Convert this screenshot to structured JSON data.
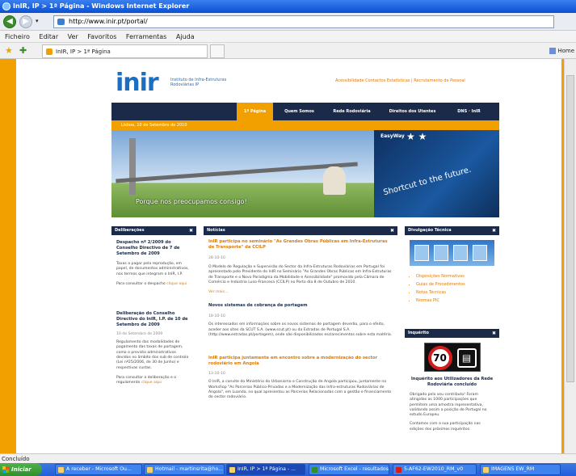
{
  "window": {
    "title": "InIR, IP > 1ª Página - Windows Internet Explorer"
  },
  "address": {
    "url": "http://www.inir.pt/portal/"
  },
  "menu": [
    "Ficheiro",
    "Editar",
    "Ver",
    "Favoritos",
    "Ferramentas",
    "Ajuda"
  ],
  "tab": {
    "label": "InIR, IP > 1ª Página"
  },
  "home_label": "Home",
  "site": {
    "logo_text": "inir",
    "logo_tagline": "Instituto de Infra-Estruturas Rodoviárias IP",
    "top_links": "Acessibilidade  Contactos  Estatísticas  |  Recrutamento de Pessoal",
    "nav": [
      "1ª Página",
      "Quem Somos",
      "Rede Rodoviária",
      "Direitos dos Utentes",
      "DNS · InIR"
    ],
    "date_text": "Lisboa, 10 de Setembro de 2010",
    "banner_caption": "Porque nos preocupamos consigo!",
    "banner_easyway": "EasyWay",
    "banner_shortcut": "Shortcut to the future.",
    "deliberacoes": {
      "heading": "Deliberações",
      "items": [
        {
          "title": "Despacho nº 2/2009 do Conselho Directivo de 7 de Setembro de 2009",
          "body": "Taxas a pagar pela reprodução, em papel, de documentos administrativos, nos termos que integram o InIR, I.P.",
          "cta": "Para consultar o despacho",
          "link": "clique aqui"
        },
        {
          "title": "Deliberação do Conselho Directivo do InIR, I.P. de 10 de Setembro de 2009",
          "date": "10 de Setembro de 2009",
          "body": "Regulamento das modalidades de pagamento das taxas de portagem, como o previsto administrativos devidos no âmbito dos sub de controlo (Lei nº25/2006, de 30 de Junho) e respectivas custas.",
          "cta": "Para consultar a deliberação e o regulamento",
          "link": "clique aqui"
        }
      ]
    },
    "noticias": {
      "heading": "Notícias",
      "items": [
        {
          "title": "InIR participa no seminário \"As Grandes Obras Públicas em Infra-Estruturas de Transporte\" da CCILP",
          "date": "28-10-10",
          "body": "O Modelo de Regulação e Supervisão do Sector da Infra-Estruturas Rodoviárias em Portugal foi apresentado pelo Presidente do InIR no Seminário \"As Grandes Obras Públicas em Infra-Estruturas de Transporte e o Novo Paradigma da Mobilidade e Acessibilidade\" promovido pela Câmara de Comércio e Indústria Luso-Francesa (CCILP) no Porto dia 8 de Outubro de 2010.",
          "more": "Ver mais..."
        },
        {
          "title": "Novos sistemas de cobrança de portagem",
          "date": "18-10-10",
          "body": "Os interessados em informações sobre os novos sistemas de portagem deverão, para o efeito, aceder aos sites da SCUT S.A. (www.scut.pt) ou da Estradas de Portugal S.A. (http://www.estradas.pt/portagem), onde são disponibilizados esclarecimentos sobre esta matéria."
        },
        {
          "title": "InIR participa juntamente em encontro sobre a modernização do sector rodoviário em Angola",
          "date": "13-10-10",
          "body": "O InIR, a convite do Ministério do Urbanismo e Construção de Angola participou, juntamente no Workshop \"As Parcerias Público-Privadas e a Modernização das Infra-estruturas Rodoviárias de Angola\", em Luanda, no qual apresentou as Parcerias Relacionadas com a gestão e financiamento do sector rodoviário."
        }
      ]
    },
    "divulgacao": {
      "heading": "Divulgação Técnica",
      "links": [
        "Disposições Normativas",
        "Guias de Procedimentos",
        "Notas Técnicas",
        "Normas PIC"
      ]
    },
    "inquerito": {
      "heading": "Inquérito",
      "sign_speed": "70",
      "title": "Inquérito aos Utilizadores da Rede Rodoviária concluído",
      "body": "Obrigado pelo seu contributo! Foram atingidas as 1000 participações que permitem uma amostra representativa, validando assim a posição de Portugal no estudo Europeu.",
      "body2": "Contamos com a sua participação nas edições dos próximos inquéritos."
    }
  },
  "status": "Concluído",
  "taskbar": {
    "start": "Iniciar",
    "tasks": [
      "A receber - Microsoft Ou...",
      "Hotmail - martinsrita@ho...",
      "InIR, IP > 1ª Página - ...",
      "Microsoft Excel - resultados",
      "5-AF62-EW2010_RM_v0",
      "IMAGENS EW_RM"
    ]
  }
}
